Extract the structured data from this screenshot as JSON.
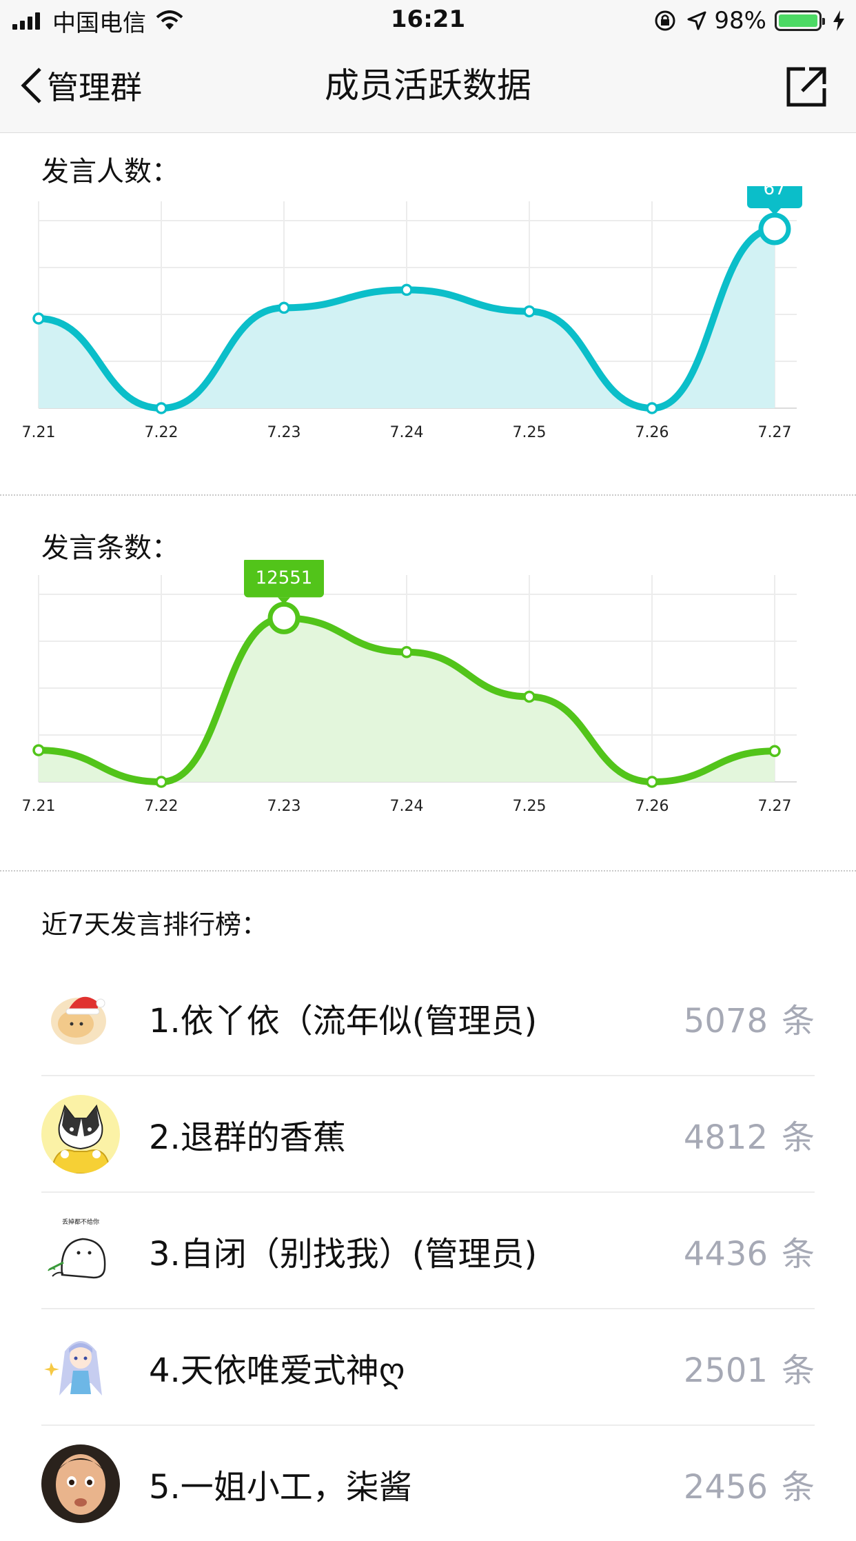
{
  "status_bar": {
    "carrier": "中国电信",
    "time": "16:21",
    "battery": "98%"
  },
  "nav": {
    "back_label": "管理群",
    "title": "成员活跃数据"
  },
  "colors": {
    "speakers": "#0bbec9",
    "speakers_fill": "#d2f2f4",
    "messages": "#52c41a",
    "messages_fill": "#e3f6dc"
  },
  "charts": {
    "speakers_title": "发言人数：",
    "messages_title": "发言条数："
  },
  "chart_data": [
    {
      "type": "area",
      "title": "发言人数：",
      "categories": [
        "7.21",
        "7.22",
        "7.23",
        "7.24",
        "7.25",
        "7.26",
        "7.27"
      ],
      "values": [
        42,
        17,
        45,
        50,
        44,
        17,
        67
      ],
      "ylim": [
        17,
        67
      ],
      "highlight": {
        "index": 6,
        "label": "67"
      },
      "grid": true
    },
    {
      "type": "area",
      "title": "发言条数：",
      "categories": [
        "7.21",
        "7.22",
        "7.23",
        "7.24",
        "7.25",
        "7.26",
        "7.27"
      ],
      "values": [
        4400,
        2450,
        12551,
        10450,
        7700,
        2450,
        4350
      ],
      "ylim": [
        2450,
        13500
      ],
      "highlight": {
        "index": 2,
        "label": "12551"
      },
      "grid": true
    }
  ],
  "ranking": {
    "title": "近7天发言排行榜：",
    "unit": "条",
    "items": [
      {
        "name": "1.依丫依（流年似(管理员)",
        "count": "5078",
        "avatar": "cat-santa-hat-avatar"
      },
      {
        "name": "2.退群的香蕉",
        "count": "4812",
        "avatar": "cat-banana-avatar"
      },
      {
        "name": "3.自闭（别找我）(管理员)",
        "count": "4436",
        "avatar": "meme-ghost-avatar"
      },
      {
        "name": "4.天依唯爱式神ღ",
        "count": "2501",
        "avatar": "anime-girl-avatar"
      },
      {
        "name": "5.一姐小工，柒酱",
        "count": "2456",
        "avatar": "child-photo-avatar"
      }
    ],
    "avatar_caption_3": "丢掉都不给你"
  }
}
